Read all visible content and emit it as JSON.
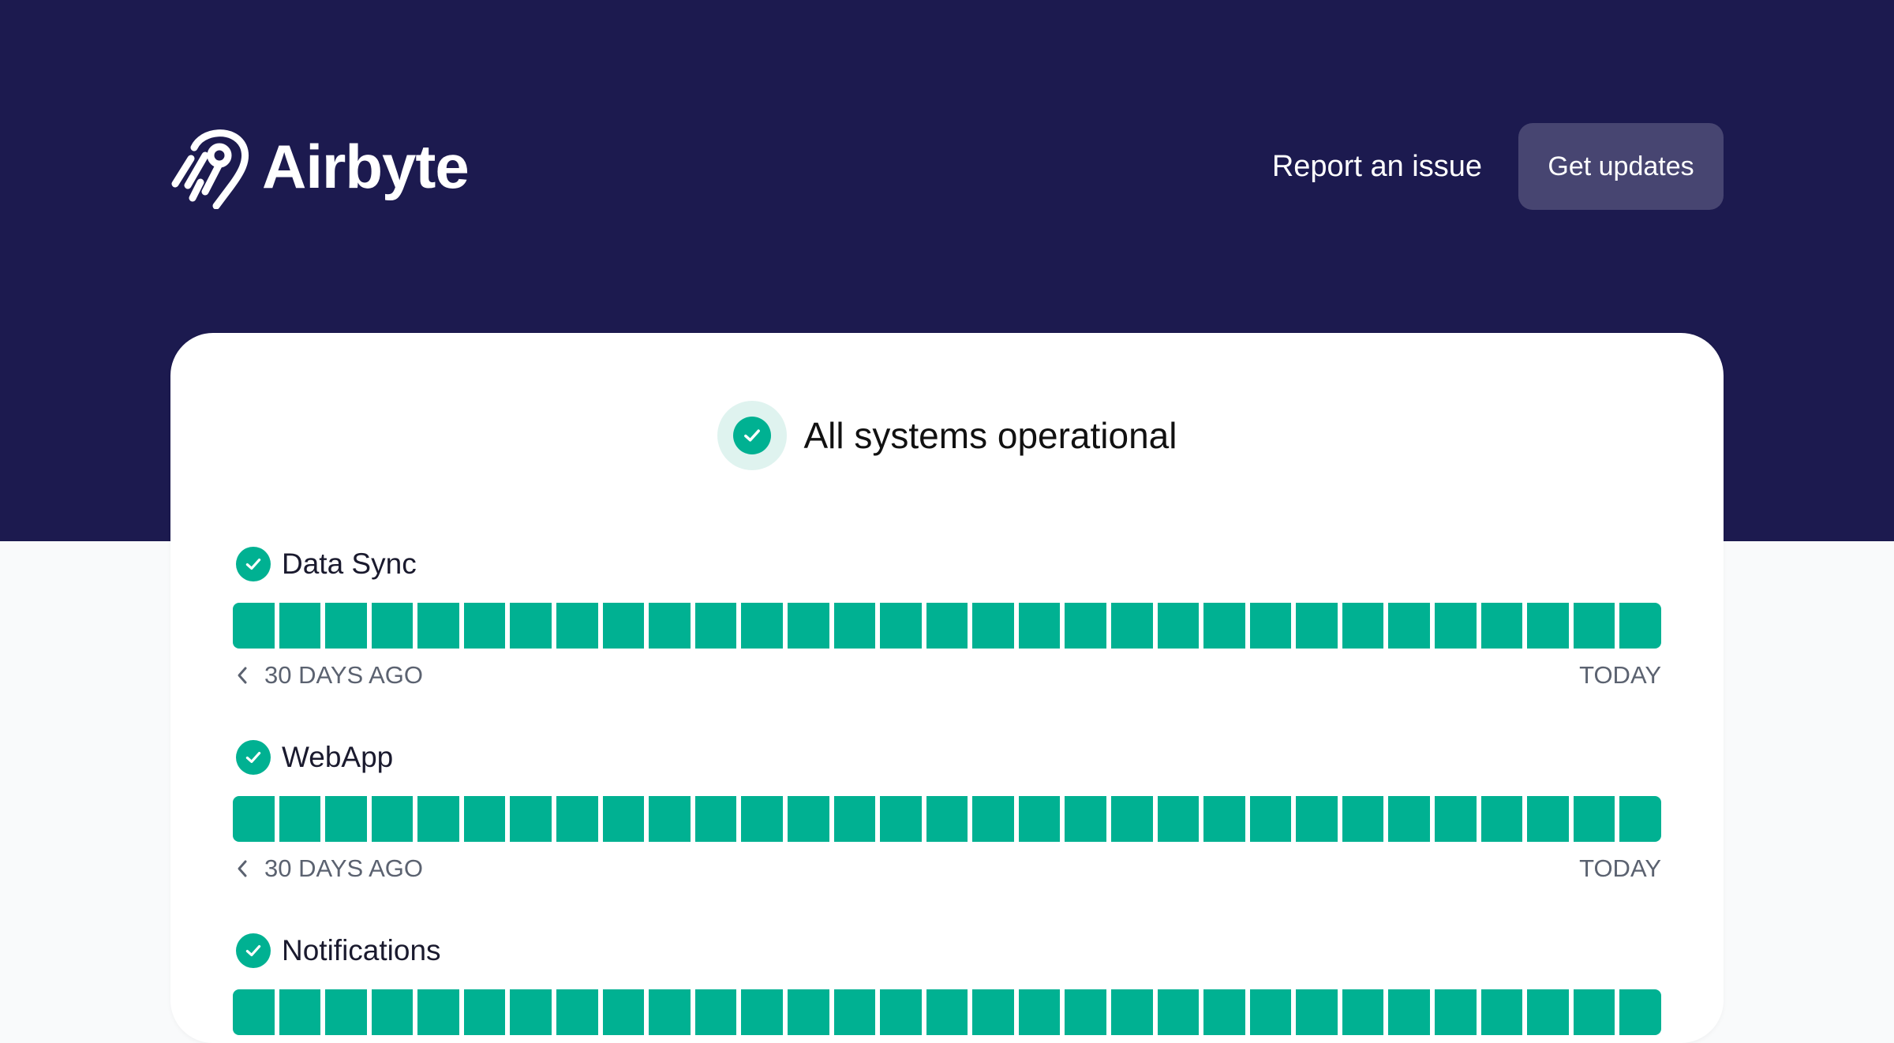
{
  "brand": {
    "name": "Airbyte",
    "logo_icon": "airbyte-octopus-icon"
  },
  "header": {
    "report_label": "Report an issue",
    "updates_label": "Get updates"
  },
  "status": {
    "overall_label": "All systems operational",
    "overall_icon": "check-circle-icon"
  },
  "colors": {
    "hero_bg": "#1c1a4f",
    "operational": "#00b192",
    "button_bg": "#474571"
  },
  "components": [
    {
      "name": "Data Sync",
      "days_shown": 31,
      "start_label": "30 DAYS AGO",
      "end_label": "TODAY"
    },
    {
      "name": "WebApp",
      "days_shown": 31,
      "start_label": "30 DAYS AGO",
      "end_label": "TODAY"
    },
    {
      "name": "Notifications",
      "days_shown": 31,
      "start_label": "",
      "end_label": ""
    }
  ]
}
